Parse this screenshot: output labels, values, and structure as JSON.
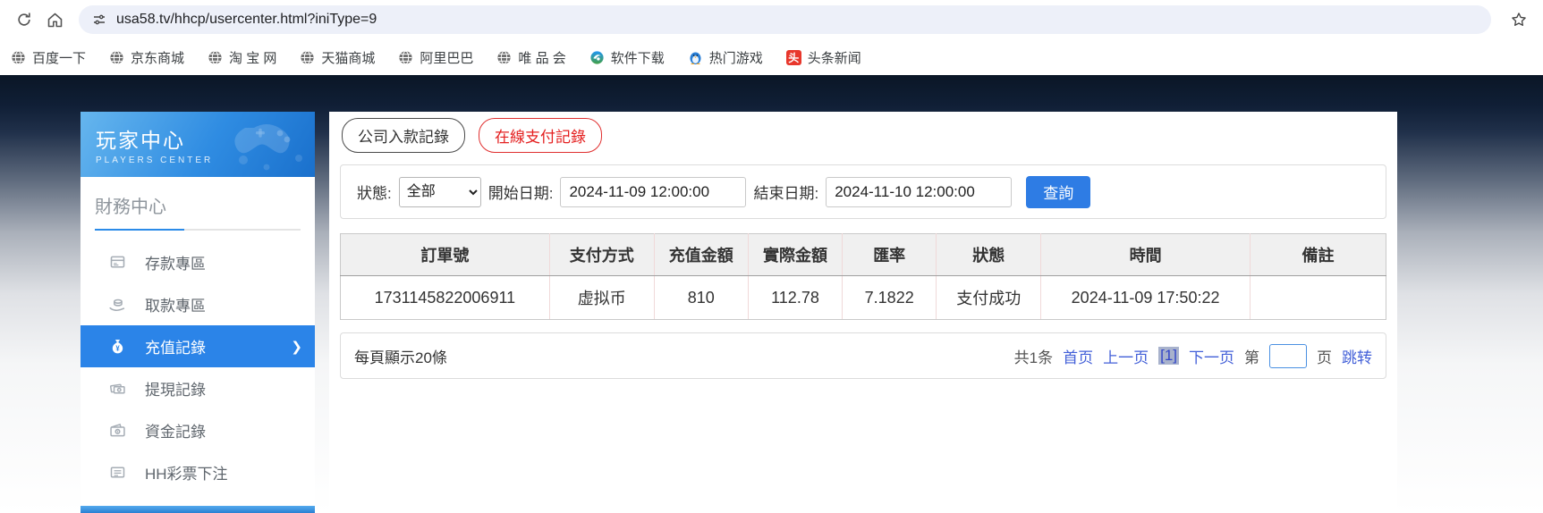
{
  "browser": {
    "url": "usa58.tv/hhcp/usercenter.html?iniType=9",
    "bookmarks": [
      {
        "label": "百度一下",
        "icon": "globe-favicon"
      },
      {
        "label": "京东商城",
        "icon": "globe-favicon"
      },
      {
        "label": "淘 宝 网",
        "icon": "globe-favicon"
      },
      {
        "label": "天猫商城",
        "icon": "globe-favicon"
      },
      {
        "label": "阿里巴巴",
        "icon": "globe-favicon"
      },
      {
        "label": "唯 品 会",
        "icon": "globe-favicon"
      },
      {
        "label": "软件下载",
        "icon": "software-download-favicon"
      },
      {
        "label": "热门游戏",
        "icon": "penguin-favicon"
      },
      {
        "label": "头条新闻",
        "icon": "toutiao-favicon",
        "glyph": "头"
      }
    ]
  },
  "sidebar": {
    "title": "玩家中心",
    "subtitle": "PLAYERS CENTER",
    "section": "財務中心",
    "items": [
      {
        "label": "存款專區",
        "icon": "deposit-zone-icon",
        "active": false
      },
      {
        "label": "取款專區",
        "icon": "withdraw-zone-icon",
        "active": false
      },
      {
        "label": "充值記錄",
        "icon": "recharge-record-icon",
        "active": true
      },
      {
        "label": "提現記錄",
        "icon": "withdrawal-record-icon",
        "active": false
      },
      {
        "label": "資金記錄",
        "icon": "funds-record-icon",
        "active": false
      },
      {
        "label": "HH彩票下注",
        "icon": "lottery-bet-icon",
        "active": false
      }
    ]
  },
  "main": {
    "tabs": [
      {
        "label": "公司入款記錄",
        "active": false
      },
      {
        "label": "在線支付記錄",
        "active": true
      }
    ],
    "filters": {
      "status_label": "狀態:",
      "status_value": "全部",
      "start_label": "開始日期:",
      "start_value": "2024-11-09 12:00:00",
      "end_label": "結束日期:",
      "end_value": "2024-11-10 12:00:00",
      "search_label": "查詢"
    },
    "table": {
      "headers": [
        "訂單號",
        "支付方式",
        "充值金額",
        "實際金額",
        "匯率",
        "狀態",
        "時間",
        "備註"
      ],
      "col_widths": [
        "20%",
        "10%",
        "9%",
        "9%",
        "9%",
        "10%",
        "20%",
        "13%"
      ],
      "rows": [
        [
          "1731145822006911",
          "虚拟币",
          "810",
          "112.78",
          "7.1822",
          "支付成功",
          "2024-11-09 17:50:22",
          ""
        ]
      ]
    },
    "pagination": {
      "page_size_text": "每頁顯示20條",
      "total_text": "共1条",
      "first_label": "首页",
      "prev_label": "上一页",
      "current_page": "[1]",
      "next_label": "下一页",
      "jump_prefix": "第",
      "jump_suffix": "页",
      "jump_label": "跳转",
      "jump_value": ""
    }
  },
  "colors": {
    "accent_blue": "#2b84e8",
    "tab_red": "#e03030",
    "link_blue": "#4360d8",
    "sidebar_header_top": "#66b6ee",
    "sidebar_header_bottom": "#1a70cc",
    "table_header_bg": "#f0f0f0",
    "table_grid_pink": "#f0d9d9"
  }
}
